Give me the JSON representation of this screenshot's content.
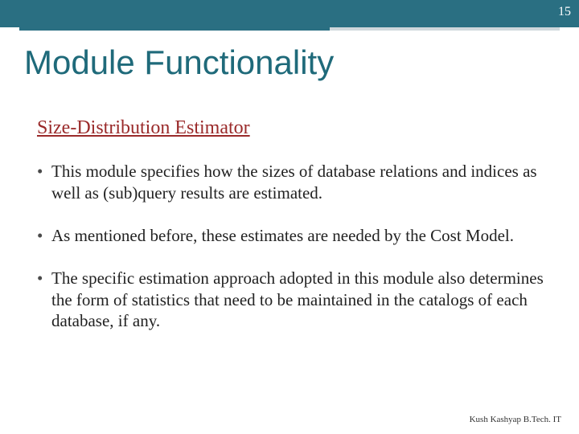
{
  "page_number": "15",
  "title": "Module Functionality",
  "subtitle": "Size-Distribution Estimator",
  "bullets": [
    "This module specifies how the sizes of database relations and indices as well as (sub)query results are estimated.",
    "As mentioned  before, these estimates are needed by the Cost Model.",
    "The specific estimation approach adopted in this module also determines the form of statistics that need to be maintained in the catalogs of each database, if any."
  ],
  "footer": "Kush Kashyap B.Tech. IT"
}
